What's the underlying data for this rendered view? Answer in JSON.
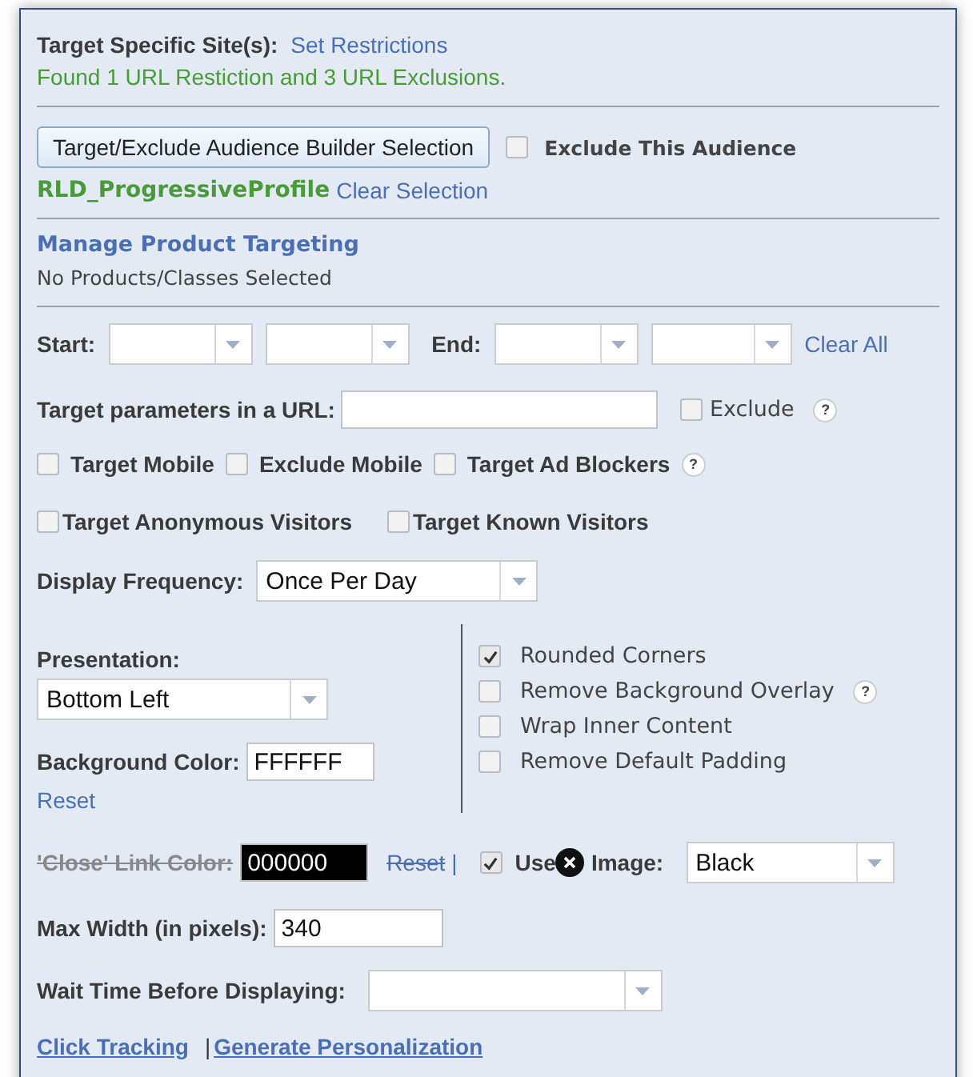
{
  "site": {
    "label": "Target Specific Site(s):",
    "link": "Set Restrictions",
    "status": "Found 1 URL Restiction and 3 URL Exclusions."
  },
  "audience": {
    "button": "Target/Exclude Audience Builder Selection",
    "exclude": {
      "label": "Exclude This Audience",
      "checked": false
    },
    "selection": "RLD_ProgressiveProfile",
    "clear": "Clear Selection"
  },
  "products": {
    "link": "Manage Product Targeting",
    "status": "No Products/Classes Selected"
  },
  "dates": {
    "start": "Start:",
    "end": "End:",
    "clear": "Clear All"
  },
  "url_params": {
    "label": "Target parameters in a URL:",
    "exclude": {
      "label": "Exclude",
      "checked": false
    },
    "help": "?"
  },
  "targeting_row_1": [
    {
      "label": "Target Mobile",
      "checked": false
    },
    {
      "label": "Exclude Mobile",
      "checked": false
    },
    {
      "label": "Target Ad Blockers",
      "checked": false,
      "help": "?"
    }
  ],
  "targeting_row_2": [
    {
      "label": "Target Anonymous Visitors",
      "checked": false
    },
    {
      "label": "Target Known Visitors",
      "checked": false
    }
  ],
  "frequency": {
    "label": "Display Frequency:",
    "value": "Once Per Day"
  },
  "presentation": {
    "label": "Presentation:",
    "value": "Bottom Left",
    "bg_label": "Background Color:",
    "bg_value": "FFFFFF",
    "reset": "Reset"
  },
  "options": [
    {
      "label": "Rounded Corners",
      "checked": true
    },
    {
      "label": "Remove Background Overlay",
      "checked": false,
      "help": "?"
    },
    {
      "label": "Wrap Inner Content",
      "checked": false
    },
    {
      "label": "Remove Default Padding",
      "checked": false
    }
  ],
  "close_link": {
    "label": "'Close' Link Color:",
    "value": "000000",
    "reset": "Reset",
    "separator": "|",
    "struck": true,
    "use_image": {
      "checked": true,
      "before": "Use",
      "after": "Image:"
    },
    "image_value": "Black"
  },
  "max_width": {
    "label": "Max Width (in pixels):",
    "value": "340"
  },
  "wait_time": {
    "label": "Wait Time Before Displaying:"
  },
  "footer": {
    "links": [
      "Click Tracking",
      "Generate Personalization"
    ],
    "separator": "|"
  }
}
